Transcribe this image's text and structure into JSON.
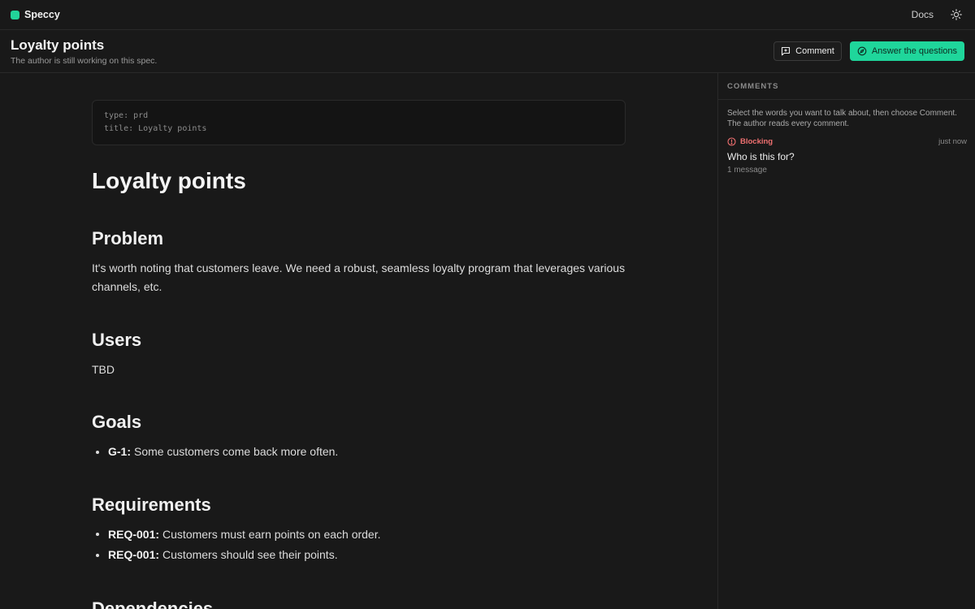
{
  "app": {
    "name": "Speccy",
    "docs_label": "Docs"
  },
  "header": {
    "title": "Loyalty points",
    "subtitle": "The author is still working on this spec.",
    "comment_button": "Comment",
    "answer_button": "Answer the questions"
  },
  "document": {
    "frontmatter": [
      "type: prd",
      "title: Loyalty points"
    ],
    "title": "Loyalty points",
    "problem": {
      "heading": "Problem",
      "text": "It's worth noting that customers leave. We need a robust, seamless loyalty program that leverages various channels, etc."
    },
    "users": {
      "heading": "Users",
      "text": "TBD"
    },
    "goals": {
      "heading": "Goals",
      "items": [
        {
          "id": "G-1:",
          "text": "Some customers come back more often."
        }
      ]
    },
    "requirements": {
      "heading": "Requirements",
      "items": [
        {
          "id": "REQ-001:",
          "text": "Customers must earn points on each order."
        },
        {
          "id": "REQ-001:",
          "text": "Customers should see their points."
        }
      ]
    },
    "dependencies": {
      "heading": "Dependencies"
    }
  },
  "comments": {
    "heading": "COMMENTS",
    "hint": "Select the words you want to talk about, then choose Comment. The author reads every comment.",
    "threads": [
      {
        "tag": "Blocking",
        "time": "just now",
        "title": "Who is this for?",
        "meta": "1 message"
      }
    ]
  },
  "colors": {
    "accent": "#1fd69b",
    "blocking": "#f07070",
    "background": "#191919"
  },
  "icons": [
    "sun-icon",
    "comment-icon",
    "compass-icon",
    "alert-circle-icon"
  ]
}
